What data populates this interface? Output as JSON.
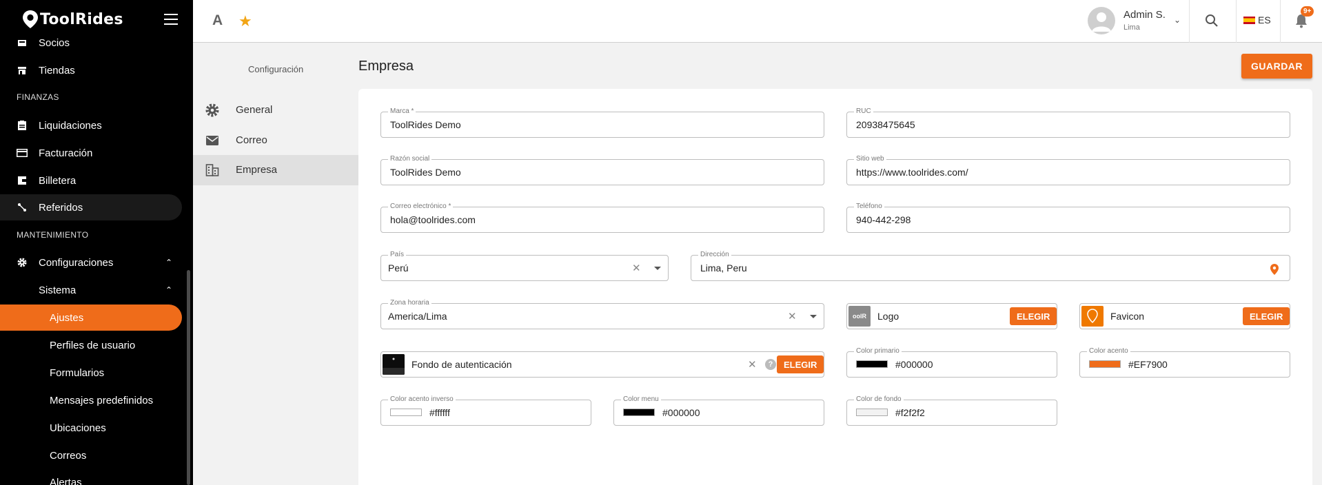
{
  "app": {
    "brand": "ToolRides"
  },
  "sidebar": {
    "items": [
      {
        "label": "Socios"
      },
      {
        "label": "Tiendas"
      },
      {
        "label": "Liquidaciones"
      },
      {
        "label": "Facturación"
      },
      {
        "label": "Billetera"
      },
      {
        "label": "Referidos"
      },
      {
        "label": "Configuraciones"
      },
      {
        "label": "Sistema"
      },
      {
        "label": "Ajustes"
      },
      {
        "label": "Perfiles de usuario"
      },
      {
        "label": "Formularios"
      },
      {
        "label": "Mensajes predefinidos"
      },
      {
        "label": "Ubicaciones"
      },
      {
        "label": "Correos"
      },
      {
        "label": "Alertas"
      }
    ],
    "sections": {
      "finance": "FINANZAS",
      "maintenance": "MANTENIMIENTO"
    }
  },
  "topbar": {
    "font_letter": "A",
    "user_name": "Admin S.",
    "user_location": "Lima",
    "language": "ES",
    "notifications": "9+"
  },
  "config_menu": {
    "title": "Configuración",
    "items": [
      {
        "label": "General",
        "icon": "gear-icon"
      },
      {
        "label": "Correo",
        "icon": "mail-icon"
      },
      {
        "label": "Empresa",
        "icon": "building-icon"
      }
    ]
  },
  "page": {
    "title": "Empresa",
    "save_label": "GUARDAR"
  },
  "form": {
    "brand": {
      "label": "Marca *",
      "value": "ToolRides Demo"
    },
    "ruc": {
      "label": "RUC",
      "value": "20938475645"
    },
    "business_name": {
      "label": "Razón social",
      "value": "ToolRides Demo"
    },
    "website": {
      "label": "Sitio web",
      "value": "https://www.toolrides.com/"
    },
    "email": {
      "label": "Correo electrónico *",
      "value": "hola@toolrides.com"
    },
    "phone": {
      "label": "Teléfono",
      "value": "940-442-298"
    },
    "country": {
      "label": "País",
      "value": "Perú"
    },
    "address": {
      "label": "Dirección",
      "value": "Lima, Peru"
    },
    "timezone": {
      "label": "Zona horaria",
      "value": "America/Lima"
    },
    "logo": {
      "label": "Logo",
      "button": "ELEGIR"
    },
    "favicon": {
      "label": "Favicon",
      "button": "ELEGIR"
    },
    "auth_background": {
      "label": "Fondo de autenticación",
      "button": "ELEGIR"
    },
    "primary_color": {
      "label": "Color primario",
      "value": "#000000"
    },
    "accent_color": {
      "label": "Color acento",
      "value": "#EF7900"
    },
    "inverse_accent_color": {
      "label": "Color acento inverso",
      "value": "#ffffff"
    },
    "menu_color": {
      "label": "Color menu",
      "value": "#000000"
    },
    "background_color": {
      "label": "Color de fondo",
      "value": "#f2f2f2"
    }
  },
  "colors": {
    "accent": "#ef6c1a",
    "sidebar_bg": "#000000",
    "page_bg": "#f2f2f2"
  }
}
